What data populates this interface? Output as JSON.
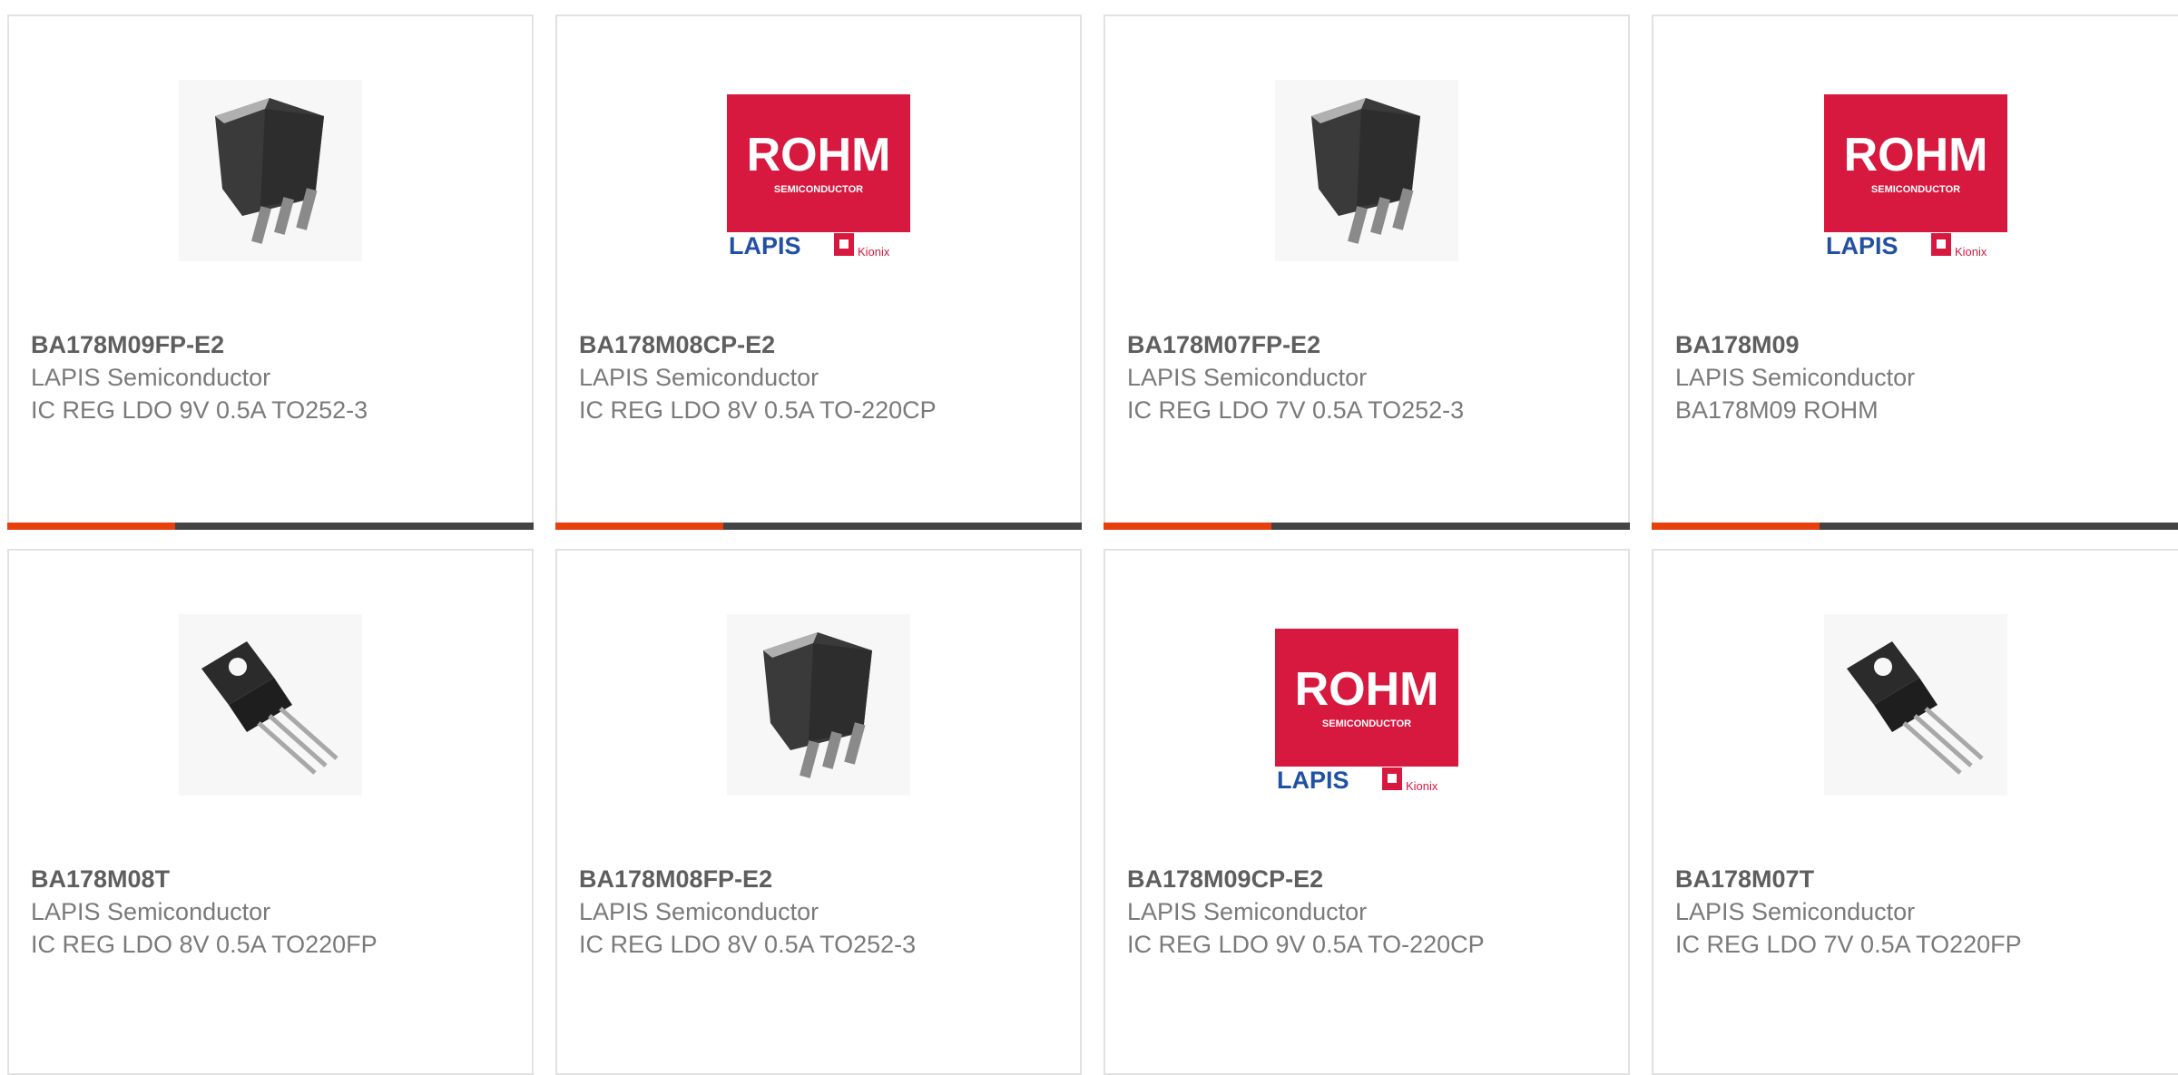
{
  "colors": {
    "accent": "#e8400c",
    "bar_dark": "#444444",
    "rohm_red": "#d7193f",
    "lapis_blue": "#2251a3"
  },
  "logo_text": {
    "rohm": "ROHM",
    "rohm_sub": "SEMICONDUCTOR",
    "lapis": "LAPIS",
    "lapis_sub": "SEMICONDUCTOR",
    "kionix": "Kionix"
  },
  "products": [
    {
      "part": "BA178M09FP-E2",
      "manufacturer": "LAPIS Semiconductor",
      "description": "IC REG LDO 9V 0.5A TO252-3",
      "image": "to252-package"
    },
    {
      "part": "BA178M08CP-E2",
      "manufacturer": "LAPIS Semiconductor",
      "description": "IC REG LDO 8V 0.5A TO-220CP",
      "image": "rohm-logo"
    },
    {
      "part": "BA178M07FP-E2",
      "manufacturer": "LAPIS Semiconductor",
      "description": "IC REG LDO 7V 0.5A TO252-3",
      "image": "to252-package"
    },
    {
      "part": "BA178M09",
      "manufacturer": "LAPIS Semiconductor",
      "description": "BA178M09 ROHM",
      "image": "rohm-logo"
    },
    {
      "part": "BA178M08T",
      "manufacturer": "LAPIS Semiconductor",
      "description": "IC REG LDO 8V 0.5A TO220FP",
      "image": "to220-package"
    },
    {
      "part": "BA178M08FP-E2",
      "manufacturer": "LAPIS Semiconductor",
      "description": "IC REG LDO 8V 0.5A TO252-3",
      "image": "to252-package"
    },
    {
      "part": "BA178M09CP-E2",
      "manufacturer": "LAPIS Semiconductor",
      "description": "IC REG LDO 9V 0.5A TO-220CP",
      "image": "rohm-logo"
    },
    {
      "part": "BA178M07T",
      "manufacturer": "LAPIS Semiconductor",
      "description": "IC REG LDO 7V 0.5A TO220FP",
      "image": "to220-package"
    }
  ]
}
